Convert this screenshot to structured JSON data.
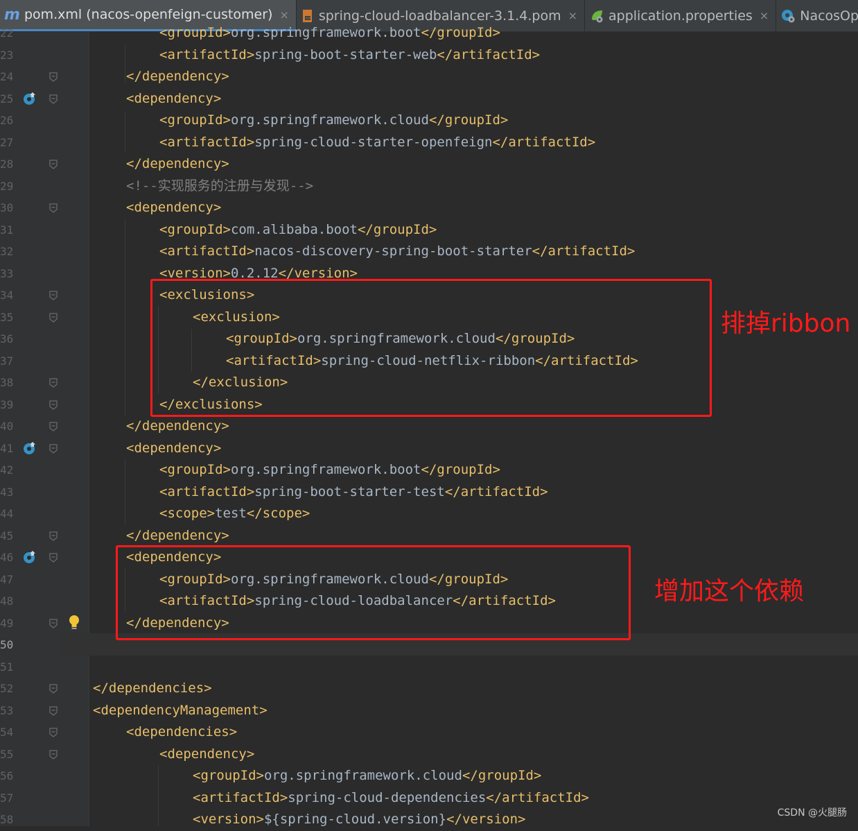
{
  "tabs": [
    {
      "label": "pom.xml (nacos-openfeign-customer)",
      "icon": "maven-icon",
      "active": true
    },
    {
      "label": "spring-cloud-loadbalancer-3.1.4.pom",
      "icon": "pom-file-icon",
      "active": false
    },
    {
      "label": "application.properties",
      "icon": "spring-config-icon",
      "active": false
    },
    {
      "label": "NacosOpenfeign",
      "icon": "spring-app-icon",
      "active": false
    }
  ],
  "close_glyph": "×",
  "lines": [
    {
      "n": "22",
      "indent": 4,
      "parts": [
        [
          "tag",
          "<groupId>"
        ],
        [
          "txt",
          "org.springframework.boot"
        ],
        [
          "tag",
          "</groupId>"
        ]
      ]
    },
    {
      "n": "23",
      "indent": 4,
      "parts": [
        [
          "tag",
          "<artifactId>"
        ],
        [
          "txt",
          "spring-boot-starter-web"
        ],
        [
          "tag",
          "</artifactId>"
        ]
      ]
    },
    {
      "n": "24",
      "indent": 2,
      "parts": [
        [
          "tag",
          "</dependency>"
        ]
      ]
    },
    {
      "n": "25",
      "indent": 2,
      "parts": [
        [
          "tag",
          "<dependency>"
        ]
      ]
    },
    {
      "n": "26",
      "indent": 4,
      "parts": [
        [
          "tag",
          "<groupId>"
        ],
        [
          "txt",
          "org.springframework.cloud"
        ],
        [
          "tag",
          "</groupId>"
        ]
      ]
    },
    {
      "n": "27",
      "indent": 4,
      "parts": [
        [
          "tag",
          "<artifactId>"
        ],
        [
          "txt",
          "spring-cloud-starter-openfeign"
        ],
        [
          "tag",
          "</artifactId>"
        ]
      ]
    },
    {
      "n": "28",
      "indent": 2,
      "parts": [
        [
          "tag",
          "</dependency>"
        ]
      ]
    },
    {
      "n": "29",
      "indent": 2,
      "parts": [
        [
          "cmt",
          "<!--实现服务的注册与发现-->"
        ]
      ]
    },
    {
      "n": "30",
      "indent": 2,
      "parts": [
        [
          "tag",
          "<dependency>"
        ]
      ]
    },
    {
      "n": "31",
      "indent": 4,
      "parts": [
        [
          "tag",
          "<groupId>"
        ],
        [
          "txt",
          "com.alibaba.boot"
        ],
        [
          "tag",
          "</groupId>"
        ]
      ]
    },
    {
      "n": "32",
      "indent": 4,
      "parts": [
        [
          "tag",
          "<artifactId>"
        ],
        [
          "txt",
          "nacos-discovery-spring-boot-starter"
        ],
        [
          "tag",
          "</artifactId>"
        ]
      ]
    },
    {
      "n": "33",
      "indent": 4,
      "parts": [
        [
          "tag",
          "<version>"
        ],
        [
          "txt",
          "0.2.12"
        ],
        [
          "tag",
          "</version>"
        ]
      ]
    },
    {
      "n": "34",
      "indent": 4,
      "parts": [
        [
          "tag",
          "<exclusions>"
        ]
      ]
    },
    {
      "n": "35",
      "indent": 6,
      "parts": [
        [
          "tag",
          "<exclusion>"
        ]
      ]
    },
    {
      "n": "36",
      "indent": 8,
      "parts": [
        [
          "tag",
          "<groupId>"
        ],
        [
          "txt",
          "org.springframework.cloud"
        ],
        [
          "tag",
          "</groupId>"
        ]
      ]
    },
    {
      "n": "37",
      "indent": 8,
      "parts": [
        [
          "tag",
          "<artifactId>"
        ],
        [
          "txt",
          "spring-cloud-netflix-ribbon"
        ],
        [
          "tag",
          "</artifactId>"
        ]
      ]
    },
    {
      "n": "38",
      "indent": 6,
      "parts": [
        [
          "tag",
          "</exclusion>"
        ]
      ]
    },
    {
      "n": "39",
      "indent": 4,
      "parts": [
        [
          "tag",
          "</exclusions>"
        ]
      ]
    },
    {
      "n": "40",
      "indent": 2,
      "parts": [
        [
          "tag",
          "</dependency>"
        ]
      ]
    },
    {
      "n": "41",
      "indent": 2,
      "parts": [
        [
          "tag",
          "<dependency>"
        ]
      ]
    },
    {
      "n": "42",
      "indent": 4,
      "parts": [
        [
          "tag",
          "<groupId>"
        ],
        [
          "txt",
          "org.springframework.boot"
        ],
        [
          "tag",
          "</groupId>"
        ]
      ]
    },
    {
      "n": "43",
      "indent": 4,
      "parts": [
        [
          "tag",
          "<artifactId>"
        ],
        [
          "txt",
          "spring-boot-starter-test"
        ],
        [
          "tag",
          "</artifactId>"
        ]
      ]
    },
    {
      "n": "44",
      "indent": 4,
      "parts": [
        [
          "tag",
          "<scope>"
        ],
        [
          "txt",
          "test"
        ],
        [
          "tag",
          "</scope>"
        ]
      ]
    },
    {
      "n": "45",
      "indent": 2,
      "parts": [
        [
          "tag",
          "</dependency>"
        ]
      ]
    },
    {
      "n": "46",
      "indent": 2,
      "parts": [
        [
          "tag",
          "<dependency>"
        ]
      ]
    },
    {
      "n": "47",
      "indent": 4,
      "parts": [
        [
          "tag",
          "<groupId>"
        ],
        [
          "txt",
          "org.springframework.cloud"
        ],
        [
          "tag",
          "</groupId>"
        ]
      ]
    },
    {
      "n": "48",
      "indent": 4,
      "parts": [
        [
          "tag",
          "<artifactId>"
        ],
        [
          "txt",
          "spring-cloud-loadbalancer"
        ],
        [
          "tag",
          "</artifactId>"
        ]
      ]
    },
    {
      "n": "49",
      "indent": 2,
      "parts": [
        [
          "tag",
          "</dependency>"
        ]
      ]
    },
    {
      "n": "50",
      "indent": 0,
      "parts": []
    },
    {
      "n": "51",
      "indent": 0,
      "parts": []
    },
    {
      "n": "52",
      "indent": 0,
      "parts": [
        [
          "tag",
          "</dependencies>"
        ]
      ]
    },
    {
      "n": "53",
      "indent": 0,
      "parts": [
        [
          "tag",
          "<dependencyManagement>"
        ]
      ]
    },
    {
      "n": "54",
      "indent": 2,
      "parts": [
        [
          "tag",
          "<dependencies>"
        ]
      ]
    },
    {
      "n": "55",
      "indent": 4,
      "parts": [
        [
          "tag",
          "<dependency>"
        ]
      ]
    },
    {
      "n": "56",
      "indent": 6,
      "parts": [
        [
          "tag",
          "<groupId>"
        ],
        [
          "txt",
          "org.springframework.cloud"
        ],
        [
          "tag",
          "</groupId>"
        ]
      ]
    },
    {
      "n": "57",
      "indent": 6,
      "parts": [
        [
          "tag",
          "<artifactId>"
        ],
        [
          "txt",
          "spring-cloud-dependencies"
        ],
        [
          "tag",
          "</artifactId>"
        ]
      ]
    },
    {
      "n": "58",
      "indent": 6,
      "parts": [
        [
          "tag",
          "<version>"
        ],
        [
          "txt",
          "${spring-cloud.version}"
        ],
        [
          "tag",
          "</version>"
        ]
      ]
    }
  ],
  "current_line": "50",
  "fold_lines": [
    "24",
    "25",
    "28",
    "30",
    "34",
    "35",
    "38",
    "39",
    "40",
    "41",
    "45",
    "46",
    "49",
    "52",
    "53",
    "54",
    "55"
  ],
  "implemented_marker_lines": [
    "25",
    "41",
    "46"
  ],
  "bulb_line": "49",
  "annotations": {
    "exclude_note": "排掉ribbon",
    "add_note": "增加这个依赖"
  },
  "watermark": "CSDN @火腿肠",
  "colors": {
    "tag": "#e8bf6a",
    "text": "#a9b7c6",
    "comment": "#808080",
    "highlight_box": "#ff1a1a",
    "editor_bg": "#2b2b2b"
  }
}
